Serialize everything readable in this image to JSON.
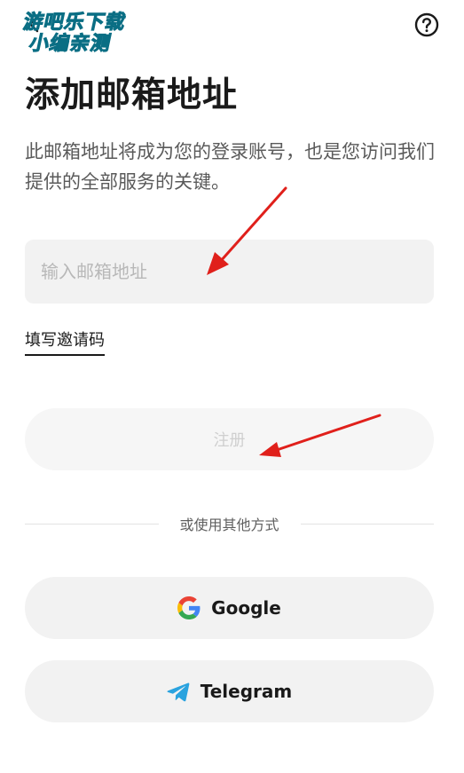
{
  "watermark": {
    "line1": "游吧乐下载",
    "line2": "小编亲测"
  },
  "header": {
    "back_icon": "chevron-left-icon",
    "help_icon": "question-circle-icon"
  },
  "main": {
    "title": "添加邮箱地址",
    "subtitle": "此邮箱地址将成为您的登录账号，也是您访问我们提供的全部服务的关键。",
    "email_input": {
      "placeholder": "输入邮箱地址",
      "value": ""
    },
    "invite_link": "填写邀请码",
    "register_label": "注册"
  },
  "divider": {
    "text": "或使用其他方式"
  },
  "social": {
    "google_label": "Google",
    "telegram_label": "Telegram"
  },
  "colors": {
    "annotation_arrow": "#e0201b",
    "watermark": "#18c1e6",
    "input_bg": "#f2f2f2",
    "telegram": "#2aa3df"
  }
}
